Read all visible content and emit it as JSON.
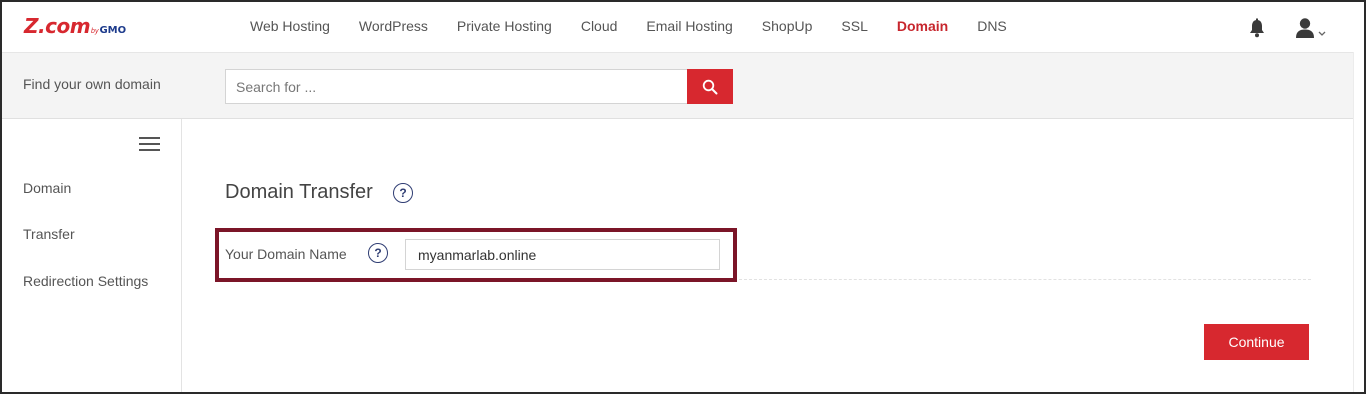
{
  "brand": {
    "name": "Z.com",
    "by": "by",
    "gmo": "GMO"
  },
  "nav": {
    "items": [
      {
        "label": "Web Hosting"
      },
      {
        "label": "WordPress"
      },
      {
        "label": "Private Hosting"
      },
      {
        "label": "Cloud"
      },
      {
        "label": "Email Hosting"
      },
      {
        "label": "ShopUp"
      },
      {
        "label": "SSL"
      },
      {
        "label": "Domain",
        "active": true
      },
      {
        "label": "DNS"
      }
    ],
    "icons": {
      "notifications": "bell-icon",
      "account": "user-icon",
      "account_menu": "chevron-down-icon"
    }
  },
  "search": {
    "label": "Find your own domain",
    "placeholder": "Search for ...",
    "value": "",
    "button_icon": "search-icon"
  },
  "sidebar": {
    "toggle_icon": "hamburger-menu-icon",
    "items": [
      {
        "label": "Domain"
      },
      {
        "label": "Transfer"
      },
      {
        "label": "Redirection Settings"
      }
    ]
  },
  "main": {
    "title": "Domain Transfer",
    "title_help_icon": "help-icon",
    "field": {
      "label": "Your Domain Name",
      "help_icon": "help-icon",
      "value": "myanmarlab.online"
    },
    "continue_label": "Continue"
  },
  "colors": {
    "brand_red": "#d7282f",
    "active_nav": "#c7262d",
    "highlight_border": "#7b1528",
    "help_icon": "#2f3d73"
  }
}
